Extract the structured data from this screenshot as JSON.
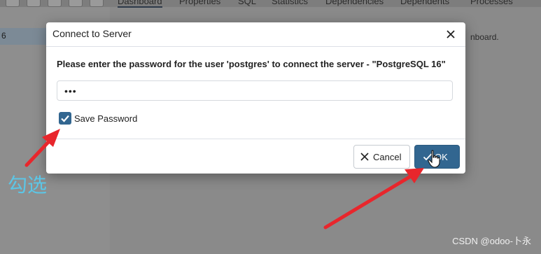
{
  "background": {
    "selected_tree_item": "6",
    "tabs": [
      "Dashboard",
      "Properties",
      "SQL",
      "Statistics",
      "Dependencies",
      "Dependents",
      "Processes"
    ],
    "hint_text": "nboard.",
    "watermark": "CSDN @odoo-卜永"
  },
  "dialog": {
    "title": "Connect to Server",
    "prompt": "Please enter the password for the user 'postgres' to connect the server - \"PostgreSQL 16\"",
    "password_value": "•••",
    "save_password_label": "Save Password",
    "save_password_checked": true,
    "cancel_label": "Cancel",
    "ok_label": "OK"
  },
  "annotation": {
    "label": "勾选",
    "label_color": "#5cc6e6",
    "arrow_color": "#e8262c"
  },
  "colors": {
    "primary": "#326690",
    "overlay": "#8c8c8c"
  },
  "icons": {
    "close": "close-icon",
    "check": "check-icon",
    "cancel": "x-icon",
    "cursor": "hand-pointer-icon"
  }
}
